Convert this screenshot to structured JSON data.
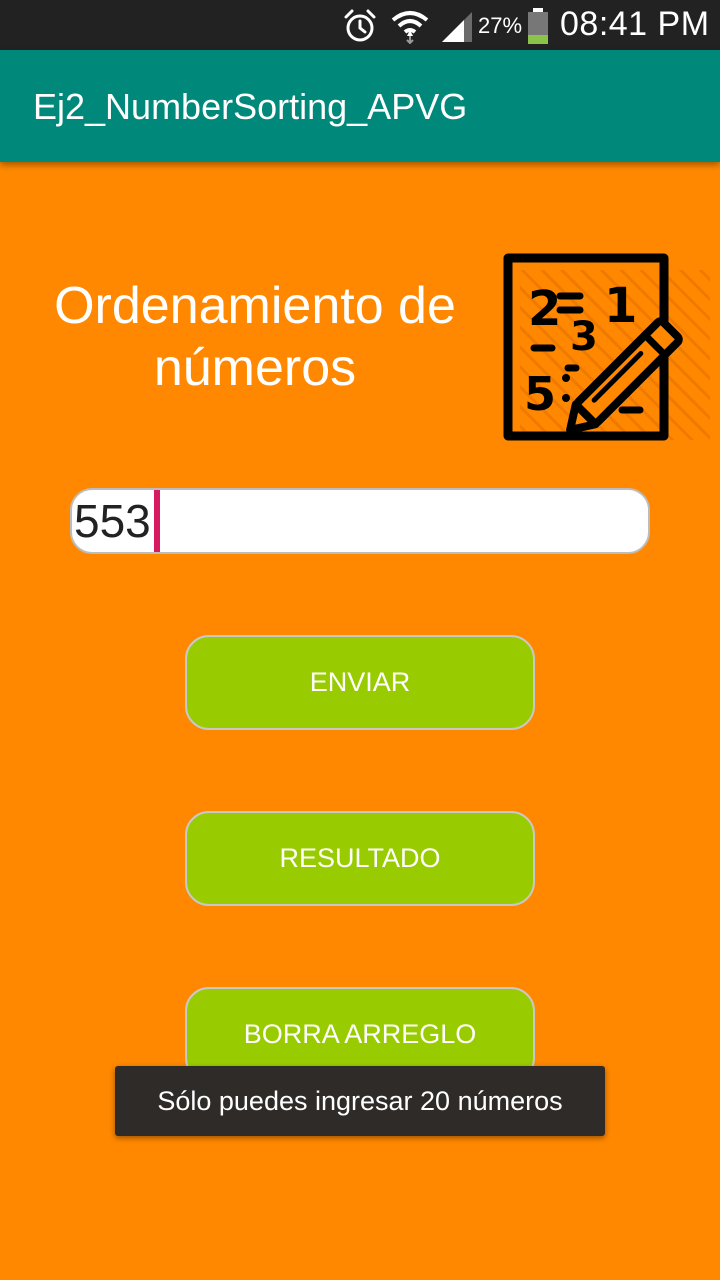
{
  "status_bar": {
    "battery_percent": "27%",
    "time": "08:41 PM",
    "icons": [
      "alarm-icon",
      "wifi-icon",
      "signal-icon",
      "battery-icon"
    ],
    "battery_level": 0.27
  },
  "app_bar": {
    "title": "Ej2_NumberSorting_APVG",
    "color": "#00897B"
  },
  "main": {
    "heading": "Ordenamiento de números",
    "illustration": "numbers-pencil-icon",
    "input": {
      "value": "553",
      "placeholder": ""
    },
    "buttons": {
      "send": "ENVIAR",
      "result": "RESULTADO",
      "clear": "BORRA ARREGLO"
    },
    "background_color": "#FF8800",
    "button_color": "#99CC00"
  },
  "toast": {
    "message": "Sólo puedes ingresar 20 números"
  }
}
